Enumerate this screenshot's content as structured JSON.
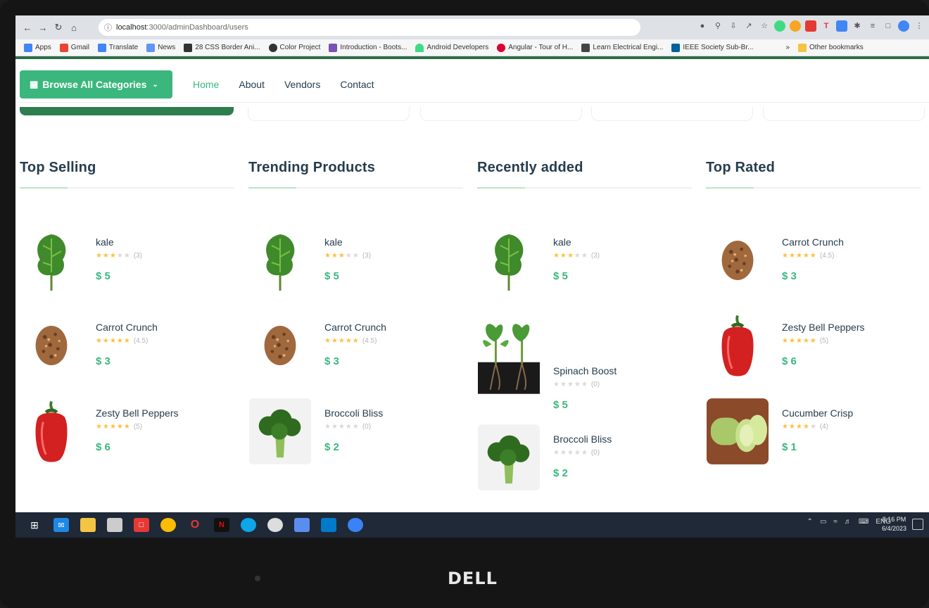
{
  "browser": {
    "url_host": "localhost",
    "url_path": ":3000/adminDashboard/users",
    "bookmarks": [
      {
        "label": "Apps",
        "color": "#4285f4"
      },
      {
        "label": "Gmail",
        "color": "#ea4335"
      },
      {
        "label": "Translate",
        "color": "#4285f4"
      },
      {
        "label": "News",
        "color": "#5e97f6"
      },
      {
        "label": "28 CSS Border Ani...",
        "color": "#333333"
      },
      {
        "label": "Color Project",
        "color": "#333333"
      },
      {
        "label": "Introduction - Boots...",
        "color": "#7952b3"
      },
      {
        "label": "Android Developers",
        "color": "#3ddc84"
      },
      {
        "label": "Angular - Tour of H...",
        "color": "#dd0031"
      },
      {
        "label": "Learn Electrical Engi...",
        "color": "#444444"
      },
      {
        "label": "IEEE Society Sub-Br...",
        "color": "#00629b"
      }
    ],
    "more": "»",
    "other_bookmarks": "Other bookmarks"
  },
  "header": {
    "browse_label": "Browse All Categories",
    "menu": [
      "Home",
      "About",
      "Vendors",
      "Contact"
    ]
  },
  "columns": [
    {
      "title": "Top Selling",
      "items": [
        {
          "name": "kale",
          "rating": 3,
          "count": "(3)",
          "price": "$ 5",
          "icon": "kale"
        },
        {
          "name": "Carrot Crunch",
          "rating": 5,
          "count": "(4.5)",
          "price": "$ 3",
          "icon": "cookie"
        },
        {
          "name": "Zesty Bell Peppers",
          "rating": 5,
          "count": "(5)",
          "price": "$ 6",
          "icon": "pepper"
        }
      ]
    },
    {
      "title": "Trending Products",
      "items": [
        {
          "name": "kale",
          "rating": 3,
          "count": "(3)",
          "price": "$ 5",
          "icon": "kale"
        },
        {
          "name": "Carrot Crunch",
          "rating": 5,
          "count": "(4.5)",
          "price": "$ 3",
          "icon": "cookie"
        },
        {
          "name": "Broccoli Bliss",
          "rating": 0,
          "count": "(0)",
          "price": "$ 2",
          "icon": "broccoli"
        }
      ]
    },
    {
      "title": "Recently added",
      "items": [
        {
          "name": "kale",
          "rating": 3,
          "count": "(3)",
          "price": "$ 5",
          "icon": "kale"
        },
        {
          "name": "Spinach Boost",
          "rating": 0,
          "count": "(0)",
          "price": "$ 5",
          "icon": "spinach"
        },
        {
          "name": "Broccoli Bliss",
          "rating": 0,
          "count": "(0)",
          "price": "$ 2",
          "icon": "broccoli"
        }
      ]
    },
    {
      "title": "Top Rated",
      "items": [
        {
          "name": "Carrot Crunch",
          "rating": 5,
          "count": "(4.5)",
          "price": "$ 3",
          "icon": "cookie"
        },
        {
          "name": "Zesty Bell Peppers",
          "rating": 5,
          "count": "(5)",
          "price": "$ 6",
          "icon": "pepper"
        },
        {
          "name": "Cucumber Crisp",
          "rating": 4,
          "count": "(4)",
          "price": "$ 1",
          "icon": "cucumber"
        }
      ]
    }
  ],
  "taskbar": {
    "lang": "ENG",
    "time": "8:16 PM",
    "date": "6/4/2023"
  },
  "brand": "DELL",
  "colors": {
    "accent": "#3bb77e",
    "star": "#fdc040",
    "heading": "#253d4e"
  }
}
